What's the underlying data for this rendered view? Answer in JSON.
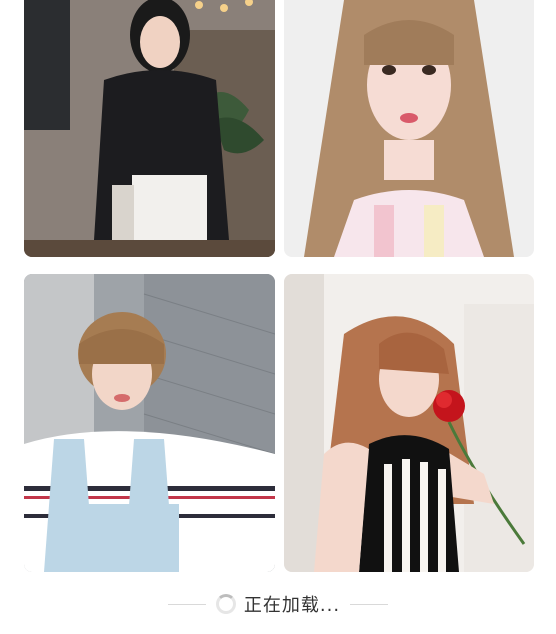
{
  "feed": {
    "items": [
      {
        "icon": "photo-woman-black-lace-top"
      },
      {
        "icon": "photo-woman-long-light-brown-hair"
      },
      {
        "icon": "photo-woman-short-hair-overalls"
      },
      {
        "icon": "photo-woman-red-rose"
      }
    ]
  },
  "loading": {
    "text": "正在加载...",
    "icon": "spinner-icon"
  }
}
